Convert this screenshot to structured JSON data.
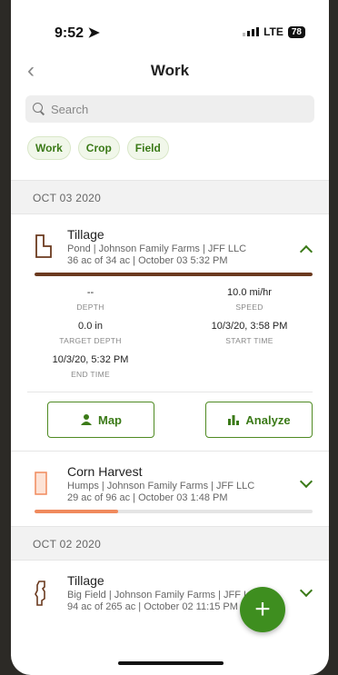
{
  "status": {
    "time": "9:52",
    "network": "LTE",
    "battery": "78"
  },
  "nav": {
    "title": "Work"
  },
  "search": {
    "placeholder": "Search"
  },
  "filters": [
    "Work",
    "Crop",
    "Field"
  ],
  "groups": [
    {
      "date": "OCT 03 2020",
      "records": [
        {
          "title": "Tillage",
          "subtitle": "Pond | Johnson Family Farms | JFF LLC",
          "detail": "36 ac of 34 ac | October 03 5:32 PM",
          "progress": 1.0,
          "progress_color": "#6b3a1f",
          "expanded": true,
          "stats": [
            {
              "value": "--",
              "label": "DEPTH"
            },
            {
              "value": "10.0 mi/hr",
              "label": "SPEED"
            },
            {
              "value": "0.0 in",
              "label": "TARGET DEPTH"
            },
            {
              "value": "10/3/20, 3:58 PM",
              "label": "START TIME"
            },
            {
              "value": "10/3/20, 5:32 PM",
              "label": "END TIME"
            }
          ],
          "actions": {
            "map": "Map",
            "analyze": "Analyze"
          }
        },
        {
          "title": "Corn Harvest",
          "subtitle": "Humps | Johnson Family Farms | JFF LLC",
          "detail": "29 ac of 96 ac | October 03 1:48 PM",
          "progress": 0.3,
          "progress_color": "#f08a5d",
          "expanded": false
        }
      ]
    },
    {
      "date": "OCT 02 2020",
      "records": [
        {
          "title": "Tillage",
          "subtitle": "Big Field | Johnson Family Farms | JFF LLC",
          "detail": "94 ac of 265 ac | October 02 11:15 PM",
          "expanded": false
        }
      ]
    }
  ],
  "fab": "+",
  "colors": {
    "accent": "#3e8e1f",
    "chip_text": "#3b7a18"
  },
  "icons": [
    "back-chevron-icon",
    "search-icon",
    "field-outline-icon",
    "map-person-icon",
    "bar-chart-icon",
    "chevron-up-icon",
    "chevron-down-icon",
    "plus-icon"
  ]
}
